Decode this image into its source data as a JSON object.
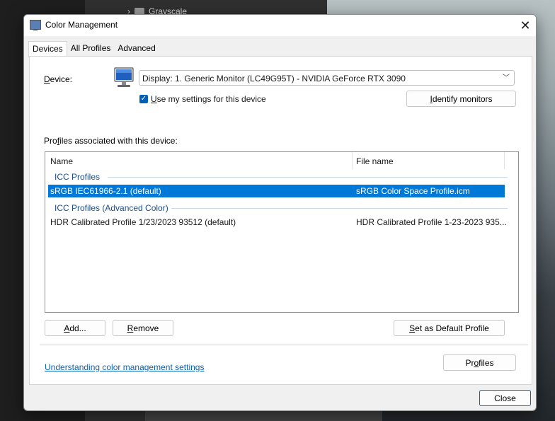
{
  "background": {
    "folder_label": "Grayscale"
  },
  "dialog": {
    "title": "Color Management",
    "close_glyph": "✕",
    "tabs": [
      {
        "label": "Devices",
        "active": true
      },
      {
        "label": "All Profiles",
        "active": false
      },
      {
        "label": "Advanced",
        "active": false
      }
    ],
    "device_label_pre": "D",
    "device_label_post": "evice:",
    "device_value": "Display: 1. Generic Monitor (LC49G95T) - NVIDIA GeForce RTX 3090",
    "use_settings_pre": "U",
    "use_settings_post": "se my settings for this device",
    "use_settings_checked": true,
    "identify_pre": "I",
    "identify_post": "dentify monitors",
    "profiles_label_pre": "Pro",
    "profiles_label_u": "f",
    "profiles_label_post": "iles associated with this device:",
    "columns": {
      "name": "Name",
      "file": "File name"
    },
    "groups": [
      {
        "label": "ICC Profiles",
        "rows": [
          {
            "name": "sRGB IEC61966-2.1 (default)",
            "file": "sRGB Color Space Profile.icm",
            "selected": true
          }
        ]
      },
      {
        "label": "ICC Profiles (Advanced Color)",
        "rows": [
          {
            "name": "HDR Calibrated Profile 1/23/2023 93512 (default)",
            "file": "HDR Calibrated Profile 1-23-2023 935...",
            "selected": false
          }
        ]
      }
    ],
    "add_pre": "A",
    "add_post": "dd...",
    "remove_pre": "R",
    "remove_post": "emove",
    "set_default_pre": "S",
    "set_default_post": "et as Default Profile",
    "link_text": "Understanding color management settings",
    "profiles_btn_pre": "Pr",
    "profiles_btn_u": "o",
    "profiles_btn_post": "files",
    "close_button": "Close"
  },
  "colors": {
    "accent": "#0078d7",
    "link": "#0b63b6",
    "checkbox": "#005fb8"
  }
}
